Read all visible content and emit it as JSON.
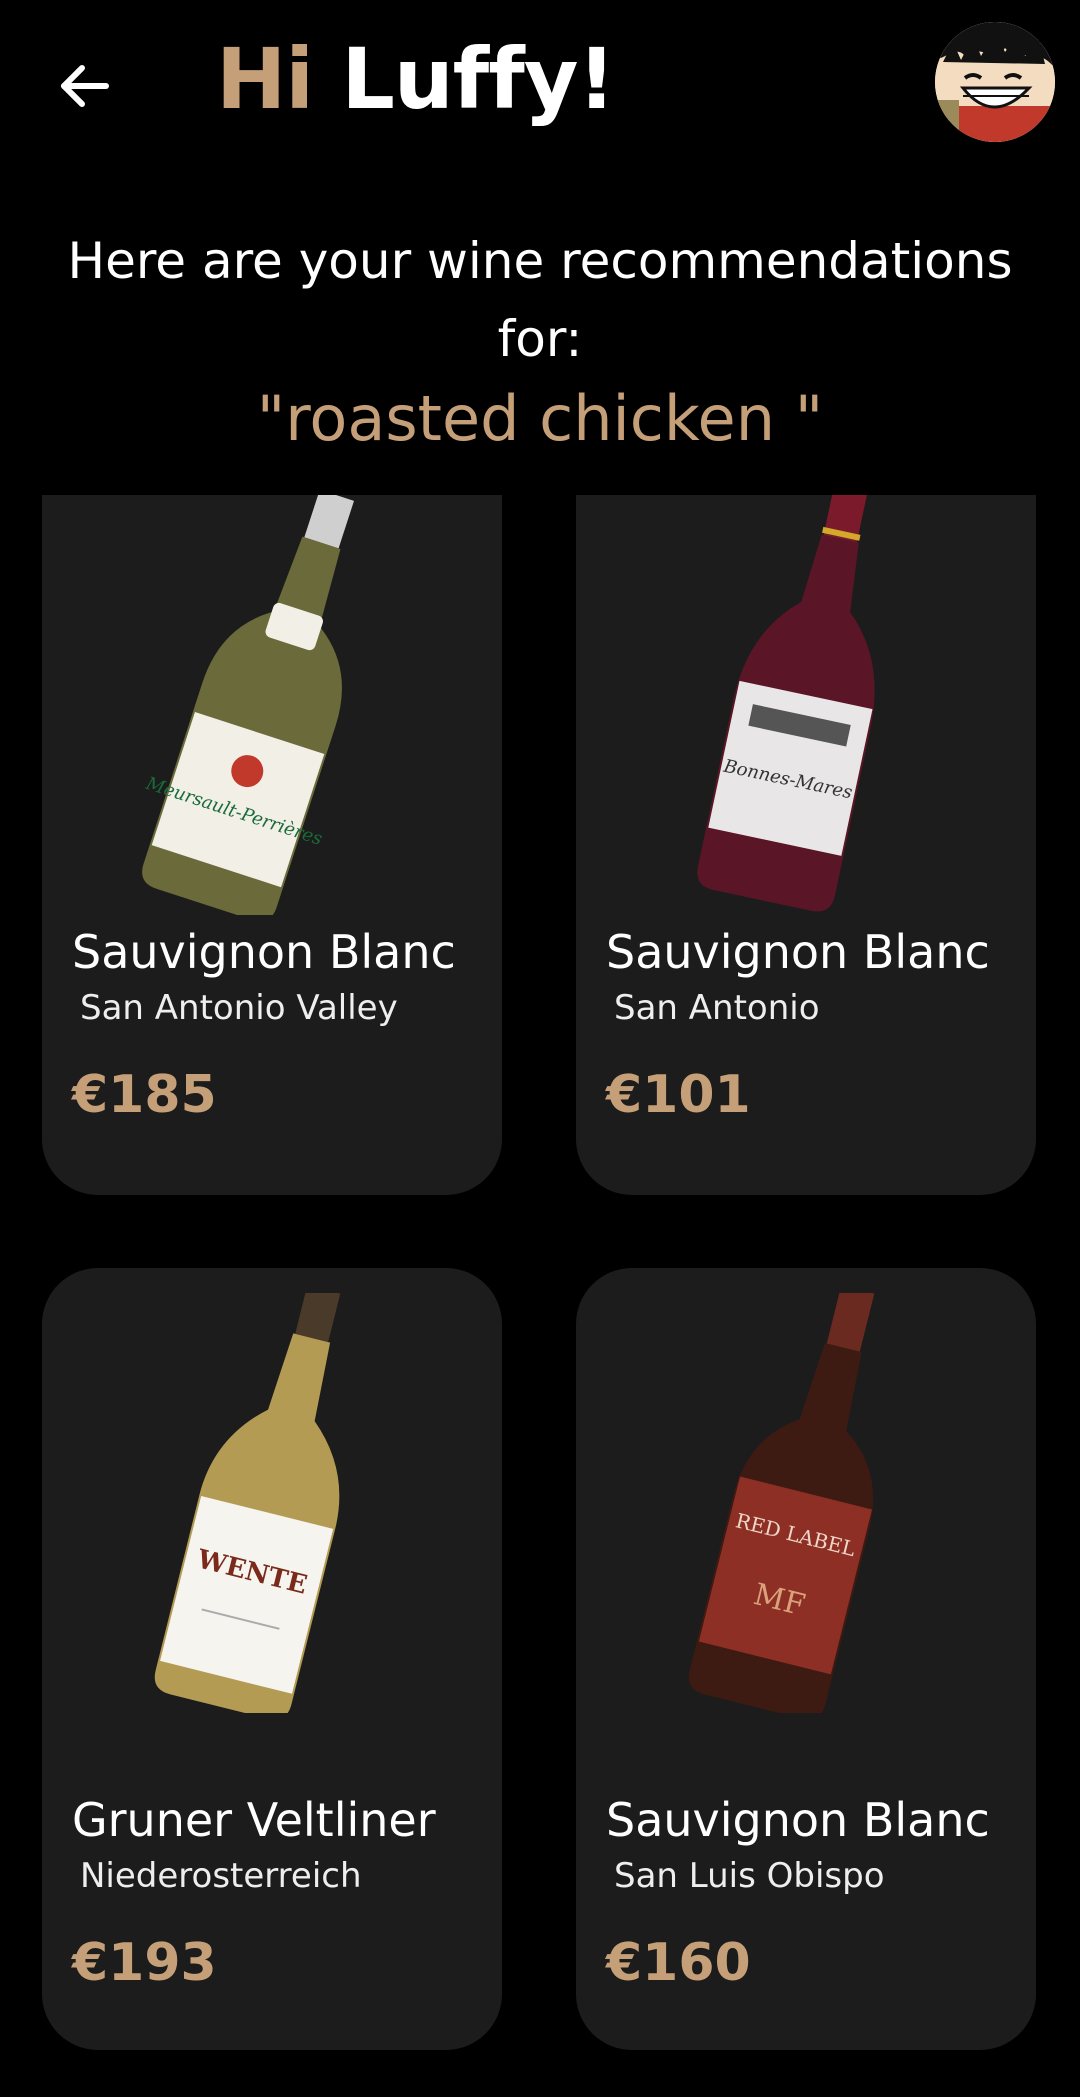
{
  "header": {
    "greeting_hi": "Hi",
    "greeting_name": "Luffy!",
    "back_icon": "arrow-left-icon",
    "avatar_alt": "user avatar"
  },
  "intro": {
    "line1": "Here are your wine recommendations",
    "line2": "for:",
    "query": "\"roasted chicken \""
  },
  "wines": [
    {
      "name": "Sauvignon Blanc",
      "region": "San Antonio Valley",
      "price": "€185",
      "bottle_label_text": "Meursault-Perrières",
      "bottle_color": "#6b6a3a",
      "label_color": "#f1efe6"
    },
    {
      "name": "Sauvignon Blanc",
      "region": "San Antonio",
      "price": "€101",
      "bottle_label_text": "Bonnes-Mares",
      "bottle_color": "#5a1626",
      "label_color": "#e9e6e8"
    },
    {
      "name": "Gruner Veltliner",
      "region": "Niederosterreich",
      "price": "€193",
      "bottle_label_text": "WENTE",
      "bottle_color": "#b39b54",
      "label_color": "#f5f4ef"
    },
    {
      "name": "Sauvignon Blanc",
      "region": "San Luis Obispo",
      "price": "€160",
      "bottle_label_text": "RED LABEL",
      "bottle_color": "#3d1a12",
      "label_color": "#8e2f26"
    }
  ],
  "colors": {
    "accent": "#c59f78",
    "card": "#1c1c1c",
    "background": "#000000"
  }
}
